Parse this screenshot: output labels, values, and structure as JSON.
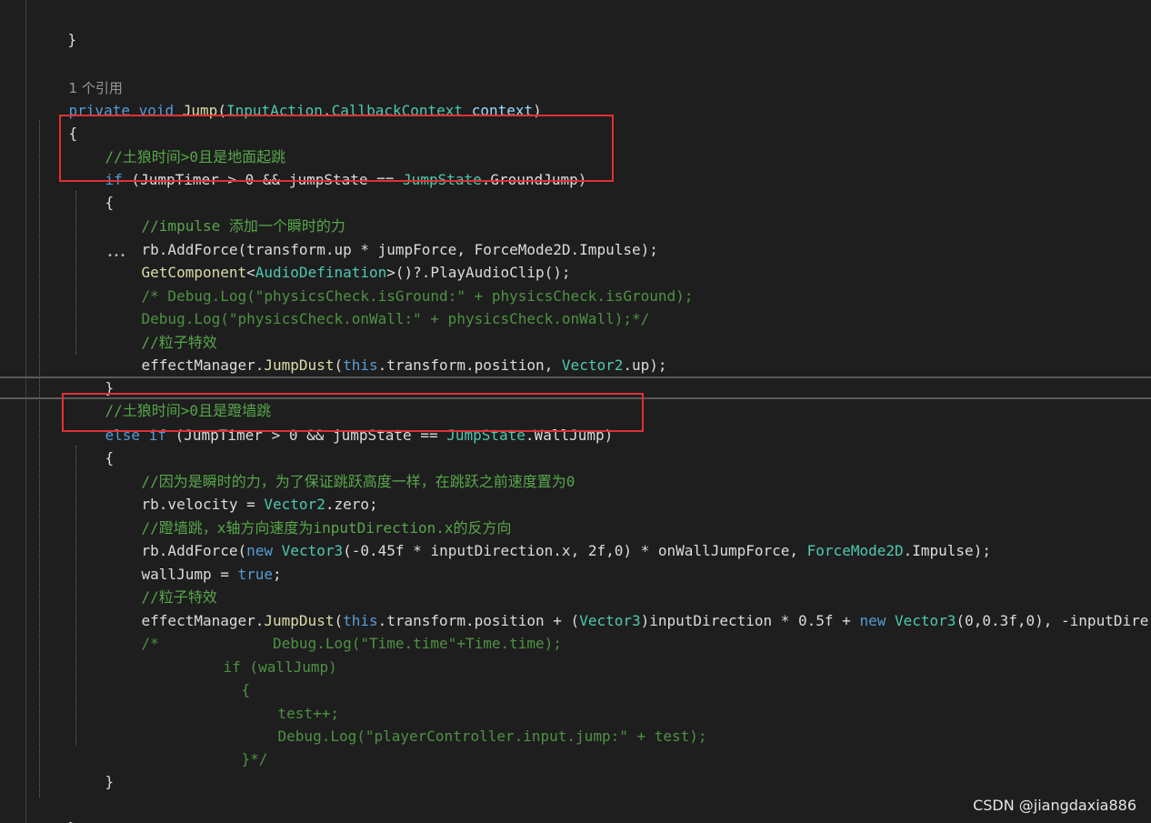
{
  "editor": {
    "l_brace_top": "}",
    "codelens": "1 个引用",
    "sig": {
      "kw1": "private",
      "kw2": "void",
      "method": "Jump",
      "ptype1": "InputAction",
      "ptype2": "CallbackContext",
      "param": "context"
    },
    "open_brace": "{",
    "c1": "//土狼时间>0且是地面起跳",
    "if1": {
      "kw": "if",
      "text": " (JumpTimer > 0 && jumpState == ",
      "type": "JumpState",
      "tail": ".GroundJump)"
    },
    "c2": "//impulse 添加一个瞬时的力",
    "l_addforce1": "rb.AddForce(transform.up * jumpForce, ForceMode2D.Impulse);",
    "l_getcomp": {
      "method": "GetComponent",
      "type": "AudioDefination",
      "tail": ">()?.PlayAudioClip();"
    },
    "c3": "/* Debug.Log(\"physicsCheck.isGround:\" + physicsCheck.isGround);",
    "c4": "Debug.Log(\"physicsCheck.onWall:\" + physicsCheck.onWall);*/",
    "c5": "//粒子特效",
    "l_dust1": {
      "pre": "effectManager.",
      "method": "JumpDust",
      "kw": "this",
      "mid": ".transform.position, ",
      "type": "Vector2",
      "tail": ".up);"
    },
    "close_brace": "}",
    "c6": "//土狼时间>0且是蹬墙跳",
    "elseif": {
      "kw1": "else",
      "kw2": "if",
      "text": " (JumpTimer > 0 && jumpState == ",
      "type": "JumpState",
      "tail": ".WallJump)"
    },
    "c7": "//因为是瞬时的力，为了保证跳跃高度一样，在跳跃之前速度置为0",
    "l_velocity": {
      "pre": "rb.velocity = ",
      "type": "Vector2",
      "tail": ".zero;"
    },
    "c8": "//蹬墙跳，x轴方向速度为inputDirection.x的反方向",
    "l_addforce2": {
      "pre": "rb.AddForce(",
      "kw": "new",
      "type": "Vector3",
      "mid": "(-0.45f * inputDirection.x, 2f,0) * onWallJumpForce, ",
      "type2": "ForceMode2D",
      "tail": ".Impulse);"
    },
    "l_walljump": {
      "pre": "wallJump = ",
      "kw": "true",
      "tail": ";"
    },
    "c9": "//粒子特效",
    "l_dust2": {
      "pre": "effectManager.",
      "method": "JumpDust",
      "kw": "this",
      "mid": ".transform.position + (",
      "type": "Vector3",
      "mid2": ")inputDirection * 0.5f + ",
      "kw2": "new",
      "type2": "Vector3",
      "tail": "(0,0.3f,0), -inputDire"
    },
    "c10": "/*             Debug.Log(\"Time.time\"+Time.time);",
    "c11": "if (wallJump)",
    "c12": "{",
    "c13": "test++;",
    "c14": "Debug.Log(\"playerController.input.jump:\" + test);",
    "c15": "}*/",
    "close_brace2": "}",
    "close_brace3": "}"
  },
  "watermark": "CSDN @jiangdaxia886",
  "colors": {
    "background": "#1e1e1e",
    "keyword": "#569cd6",
    "type": "#4ec9b0",
    "method": "#dcdcaa",
    "comment": "#57a64a",
    "highlight": "#e03131"
  }
}
